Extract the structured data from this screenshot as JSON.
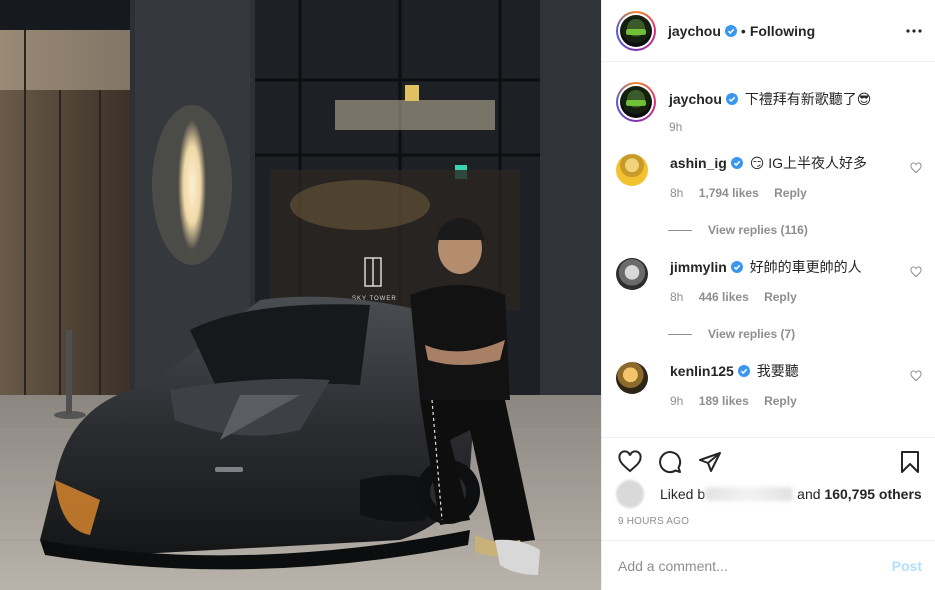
{
  "colors": {
    "verified_blue": "#3897f0",
    "meta_gray": "#8e8e8e",
    "post_button_disabled": "#b2dffc",
    "text": "#262626"
  },
  "photo": {
    "sign_text": "SKY TOWER"
  },
  "header": {
    "username": "jaychou",
    "dot": "•",
    "follow_status": "Following",
    "more_icon": "ellipsis-icon"
  },
  "caption": {
    "username": "jaychou",
    "text": "下禮拜有新歌聽了",
    "emoji": "😎",
    "time": "9h"
  },
  "comments": [
    {
      "username": "ashin_ig",
      "emoji": "😏",
      "text": "IG上半夜人好多",
      "time": "8h",
      "likes": "1,794 likes",
      "reply": "Reply",
      "view_replies": "View replies (116)"
    },
    {
      "username": "jimmylin",
      "emoji": "",
      "text": "好帥的車更帥的人",
      "time": "8h",
      "likes": "446 likes",
      "reply": "Reply",
      "view_replies": "View replies (7)"
    },
    {
      "username": "kenlin125",
      "emoji": "",
      "text": "我要聽",
      "time": "9h",
      "likes": "189 likes",
      "reply": "Reply",
      "view_replies": ""
    }
  ],
  "actions": {
    "like_icon": "heart-icon",
    "comment_icon": "comment-icon",
    "share_icon": "share-icon",
    "save_icon": "bookmark-icon"
  },
  "likes_summary": {
    "prefix": "Liked b",
    "middle": "and",
    "count": "160,795 others"
  },
  "timestamp": "9 HOURS AGO",
  "add_comment": {
    "placeholder": "Add a comment...",
    "post_label": "Post"
  }
}
